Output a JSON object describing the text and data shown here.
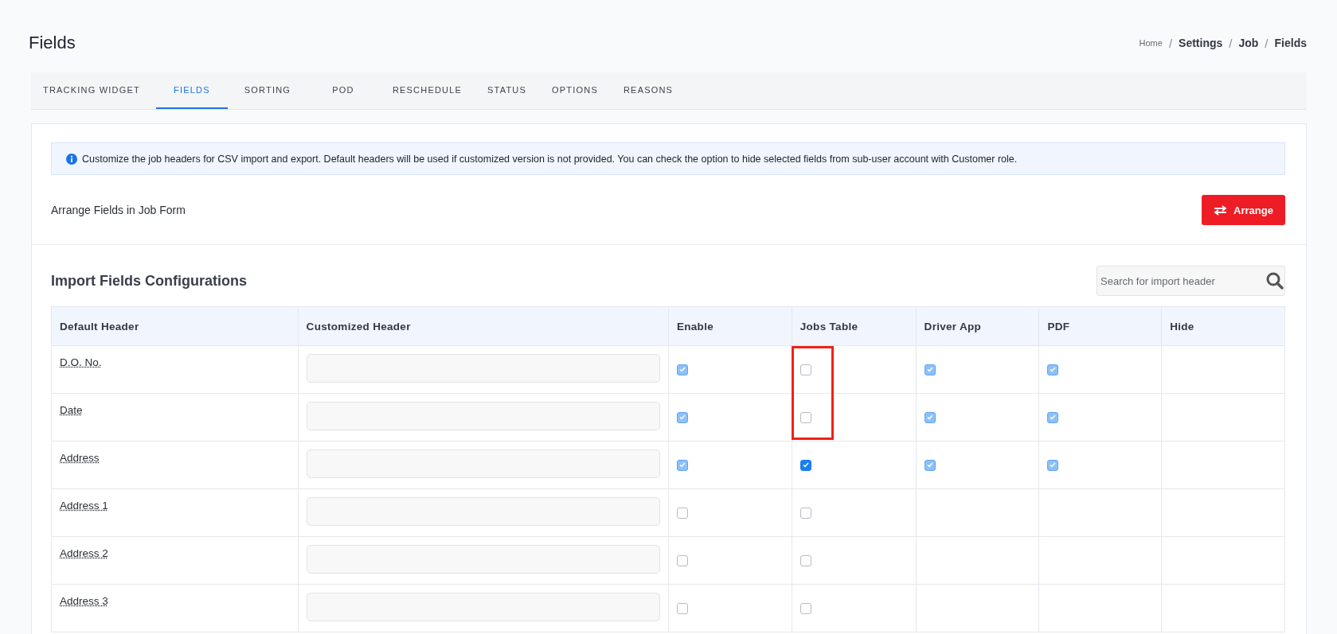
{
  "page": {
    "title": "Fields"
  },
  "breadcrumb": [
    {
      "label": "Home",
      "current": false
    },
    {
      "label": "Settings",
      "current": true
    },
    {
      "label": "Job",
      "current": true
    },
    {
      "label": "Fields",
      "current": true
    }
  ],
  "breadcrumb_separator": "/",
  "tabs": [
    {
      "label": "TRACKING WIDGET",
      "selected": false
    },
    {
      "label": "FIELDS",
      "selected": true
    },
    {
      "label": "SORTING",
      "selected": false
    },
    {
      "label": "POD",
      "selected": false
    },
    {
      "label": "RESCHEDULE",
      "selected": false
    },
    {
      "label": "STATUS",
      "selected": false
    },
    {
      "label": "OPTIONS",
      "selected": false
    },
    {
      "label": "REASONS",
      "selected": false
    }
  ],
  "info_alert": "Customize the job headers for CSV import and export. Default headers will be used if customized version is not provided. You can check the option to hide selected fields from sub-user account with Customer role.",
  "arrange": {
    "label": "Arrange Fields in Job Form",
    "button": "Arrange"
  },
  "import_section": {
    "title": "Import Fields Configurations",
    "search": {
      "placeholder": "Search for import header"
    }
  },
  "table": {
    "columns": [
      "Default Header",
      "Customized Header",
      "Enable",
      "Jobs Table",
      "Driver App",
      "PDF",
      "Hide"
    ],
    "rows": [
      {
        "label": "D.O. No.",
        "highlighted": true,
        "checks": [
          {
            "checked": true,
            "disabled": true
          },
          {
            "checked": false,
            "disabled": false
          },
          {
            "checked": true,
            "disabled": true
          },
          {
            "checked": true,
            "disabled": true
          }
        ]
      },
      {
        "label": "Date",
        "highlighted": true,
        "checks": [
          {
            "checked": true,
            "disabled": true
          },
          {
            "checked": false,
            "disabled": false
          },
          {
            "checked": true,
            "disabled": true
          },
          {
            "checked": true,
            "disabled": true
          }
        ]
      },
      {
        "label": "Address",
        "highlighted": false,
        "checks": [
          {
            "checked": true,
            "disabled": true
          },
          {
            "checked": true,
            "disabled": false
          },
          {
            "checked": true,
            "disabled": true
          },
          {
            "checked": true,
            "disabled": true
          }
        ]
      },
      {
        "label": "Address 1",
        "highlighted": false,
        "checks": [
          {
            "checked": false,
            "disabled": false
          },
          {
            "checked": false,
            "disabled": false
          }
        ]
      },
      {
        "label": "Address 2",
        "highlighted": false,
        "checks": [
          {
            "checked": false,
            "disabled": false
          },
          {
            "checked": false,
            "disabled": false
          }
        ]
      },
      {
        "label": "Address 3",
        "highlighted": false,
        "checks": [
          {
            "checked": false,
            "disabled": false
          },
          {
            "checked": false,
            "disabled": false
          }
        ]
      }
    ]
  }
}
